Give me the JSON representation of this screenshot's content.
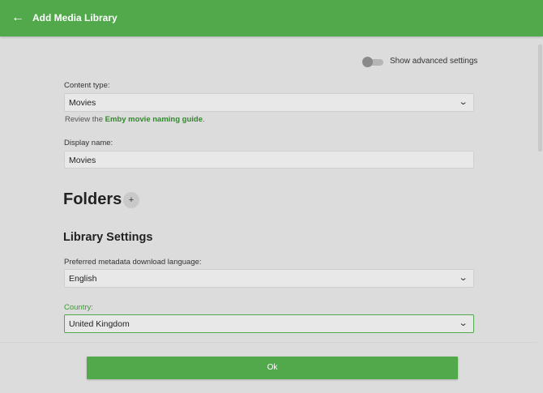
{
  "header": {
    "title": "Add Media Library",
    "back_icon": "arrow-left-icon"
  },
  "advanced_toggle": {
    "label": "Show advanced settings",
    "checked": false
  },
  "content_type": {
    "label": "Content type:",
    "value": "Movies",
    "help_prefix": "Review the ",
    "help_link": "Emby movie naming guide",
    "help_suffix": "."
  },
  "display_name": {
    "label": "Display name:",
    "value": "Movies"
  },
  "folders": {
    "heading": "Folders",
    "add_label": "+"
  },
  "library_settings": {
    "heading": "Library Settings",
    "language": {
      "label": "Preferred metadata download language:",
      "value": "English"
    },
    "country": {
      "label": "Country:",
      "value": "United Kingdom"
    }
  },
  "footer": {
    "ok_label": "Ok"
  },
  "colors": {
    "accent": "#52a94c",
    "link": "#2f8a2a"
  }
}
